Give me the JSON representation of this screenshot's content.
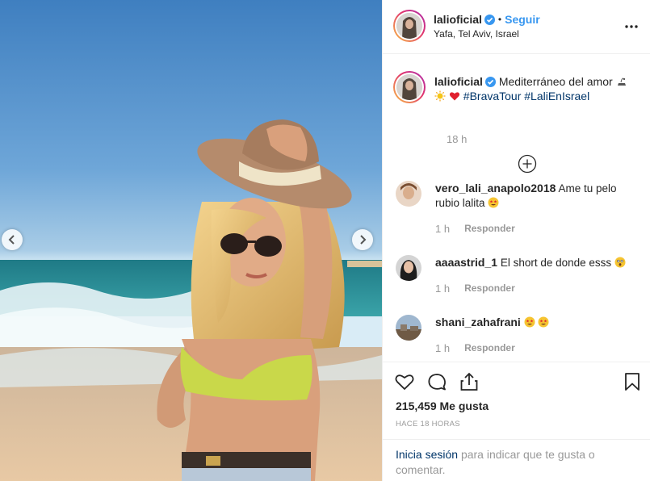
{
  "post": {
    "username": "lalioficial",
    "follow_label": "Seguir",
    "separator": "•",
    "location": "Yafa, Tel Aviv, Israel",
    "caption_main": "Mediterráneo del amor",
    "hashtags": "#BravaTour #LaliEnIsrael",
    "caption_time": "18 h"
  },
  "comments": [
    {
      "username": "vero_lali_anapolo2018",
      "text": "Ame tu pelo rubio lalita",
      "time": "1 h",
      "reply": "Responder"
    },
    {
      "username": "aaaastrid_1",
      "text": "El short de donde esss",
      "time": "1 h",
      "reply": "Responder"
    },
    {
      "username": "shani_zahafrani",
      "text": "",
      "time": "1 h",
      "reply": "Responder"
    }
  ],
  "stats": {
    "likes": "215,459 Me gusta",
    "ago": "HACE 18 HORAS"
  },
  "login": {
    "link": "Inicia sesión",
    "rest": "para indicar que te gusta o comentar."
  },
  "colors": {
    "link_blue": "#3897f0",
    "hashtag": "#003569",
    "muted": "#999999",
    "verified": "#3897f0"
  },
  "icons": [
    "chevron-left-icon",
    "chevron-right-icon",
    "more-icon",
    "verified-icon",
    "plus-circle-icon",
    "heart-icon",
    "comment-icon",
    "share-icon",
    "bookmark-icon"
  ]
}
